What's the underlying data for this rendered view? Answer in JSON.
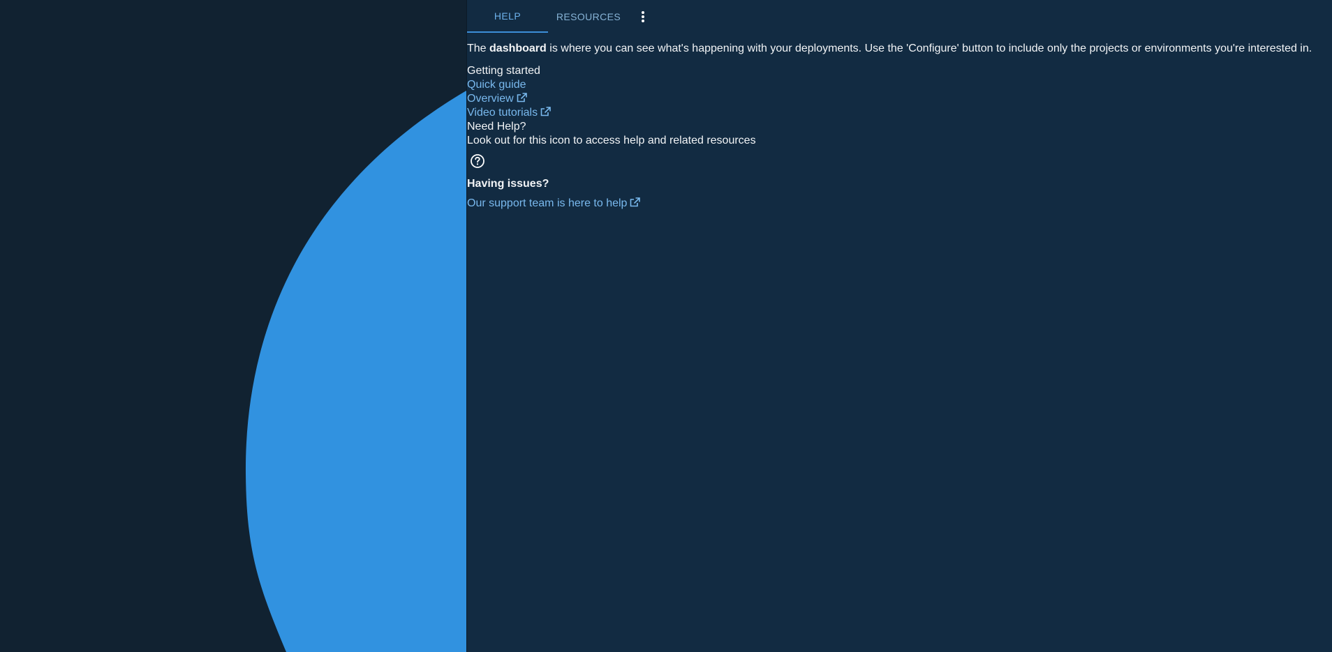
{
  "colors": {
    "left_background": "#112231",
    "decorative_shape": "#3192e0",
    "panel_background": "#122b42",
    "link": "#79b9ee",
    "tab_active": "#6db1eb",
    "tab_indicator": "#3d8ed8"
  },
  "tabs": [
    {
      "label": "HELP",
      "active": true
    },
    {
      "label": "RESOURCES",
      "active": false
    }
  ],
  "tab_more_icon": "vertical-ellipsis-icon",
  "intro": {
    "prefix": "The ",
    "bold": "dashboard",
    "suffix": " is where you can see what's happening with your deployments. Use the 'Configure' button to include only the projects or environments you're interested in."
  },
  "getting_started": {
    "title": "Getting started",
    "links": [
      {
        "label": "Quick guide",
        "external": false
      },
      {
        "label": "Overview",
        "external": true,
        "icon": "external-link-icon"
      },
      {
        "label": "Video tutorials",
        "external": true,
        "icon": "external-link-icon"
      }
    ]
  },
  "need_help": {
    "title": "Need Help?",
    "text": "Look out for this icon to access help and related resources",
    "icon": "question-circle-icon"
  },
  "issues": {
    "title": "Having issues?",
    "support_link": "Our support team is here to help",
    "support_icon": "external-link-icon"
  }
}
